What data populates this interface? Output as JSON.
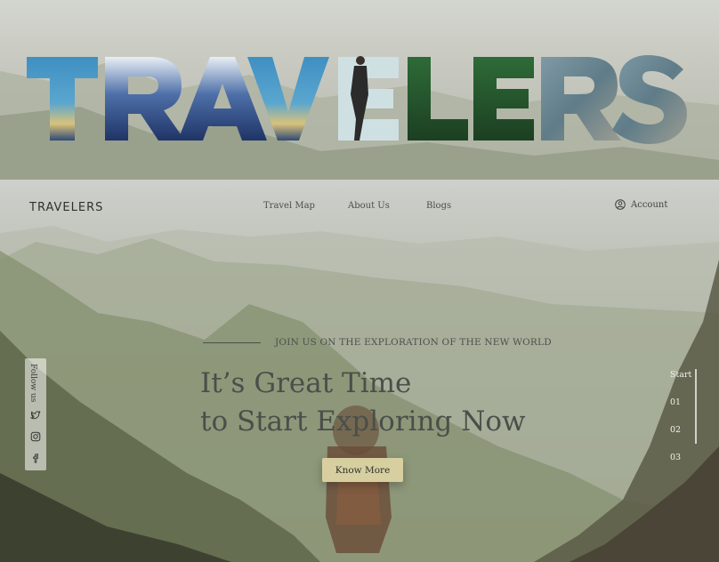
{
  "banner": {
    "title": "TRAVELERS"
  },
  "header": {
    "logo": "TRAVELERS",
    "nav": [
      "Travel Map",
      "About Us",
      "Blogs"
    ],
    "account_label": "Account",
    "account_icon": "user-icon"
  },
  "hero": {
    "kicker": "JOIN US ON THE EXPLORATION OF THE NEW WORLD",
    "headline_line1": "It’s Great Time",
    "headline_line2": "to Start Exploring Now",
    "cta": "Know More"
  },
  "follow": {
    "label": "Follow us",
    "icons": [
      "twitter-icon",
      "instagram-icon",
      "facebook-icon"
    ]
  },
  "slider": {
    "labels": [
      "Start",
      "01",
      "02",
      "03"
    ]
  },
  "colors": {
    "cta_bg": "#d7cf9f",
    "text_dark": "#4a4f4a"
  }
}
